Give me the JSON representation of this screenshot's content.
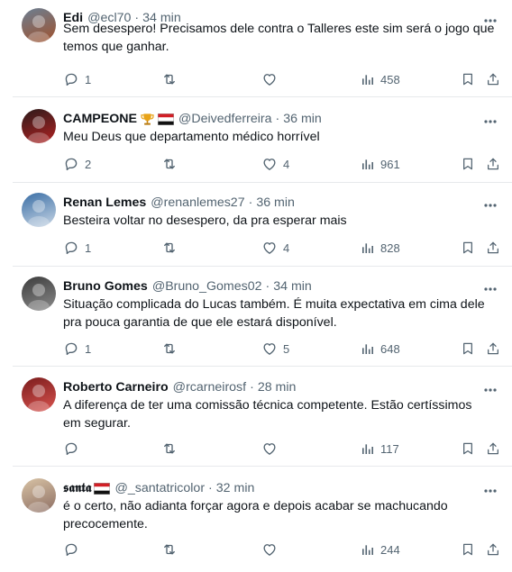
{
  "tweets": [
    {
      "name": "Edi",
      "handle": "@ecl70",
      "time": "34 min",
      "badges": [],
      "lines": [
        "Sem desespero! Precisamos dele contra o Talleres este sim será o jogo que",
        "temos que ganhar."
      ],
      "replies": "1",
      "retweets": "",
      "likes": "",
      "views": "458",
      "avatar_colors": [
        "#6b7f93",
        "#a0522d"
      ]
    },
    {
      "name": "CAMPEONE",
      "handle": "@Deivedferreira",
      "time": "36 min",
      "badges": [
        "trophy-icon",
        "flag-icon"
      ],
      "lines": [
        "Meu Deus que departamento médico horrível"
      ],
      "replies": "2",
      "retweets": "",
      "likes": "4",
      "views": "961",
      "avatar_colors": [
        "#2b1b1b",
        "#b22222"
      ]
    },
    {
      "name": "Renan Lemes",
      "handle": "@renanlemes27",
      "time": "36 min",
      "badges": [],
      "lines": [
        "Besteira voltar no desespero, da pra esperar mais"
      ],
      "replies": "1",
      "retweets": "",
      "likes": "4",
      "views": "828",
      "avatar_colors": [
        "#3a6ea5",
        "#c8d6e5"
      ]
    },
    {
      "name": "Bruno Gomes",
      "handle": "@Bruno_Gomes02",
      "time": "34 min",
      "badges": [],
      "lines": [
        "Situação complicada do Lucas também. É muita expectativa em cima dele",
        "pra pouca garantia de que ele estará disponível."
      ],
      "replies": "1",
      "retweets": "",
      "likes": "5",
      "views": "648",
      "avatar_colors": [
        "#3c3c3c",
        "#8a8a8a"
      ]
    },
    {
      "name": "Roberto Carneiro",
      "handle": "@rcarneirosf",
      "time": "28 min",
      "badges": [],
      "lines": [
        "A diferença de ter uma comissão técnica competente. Estão certíssimos",
        "em segurar."
      ],
      "replies": "",
      "retweets": "",
      "likes": "",
      "views": "117",
      "avatar_colors": [
        "#7a1c1c",
        "#d9534f"
      ]
    },
    {
      "name": "𝖘𝖆𝖓𝖙𝖆",
      "handle": "@_santatricolor",
      "time": "32 min",
      "badges": [
        "flag-icon"
      ],
      "lines": [
        "é o certo, não adianta forçar agora e depois acabar se machucando",
        "precocemente."
      ],
      "replies": "",
      "retweets": "",
      "likes": "",
      "views": "244",
      "avatar_colors": [
        "#d8c3a5",
        "#8d6e63"
      ]
    }
  ],
  "colors": {
    "text": "#0f1419",
    "muted": "#536471",
    "divider": "#e7e9ec",
    "flag_red": "#d21f26",
    "flag_black": "#111111",
    "trophy": "#e8a317"
  }
}
